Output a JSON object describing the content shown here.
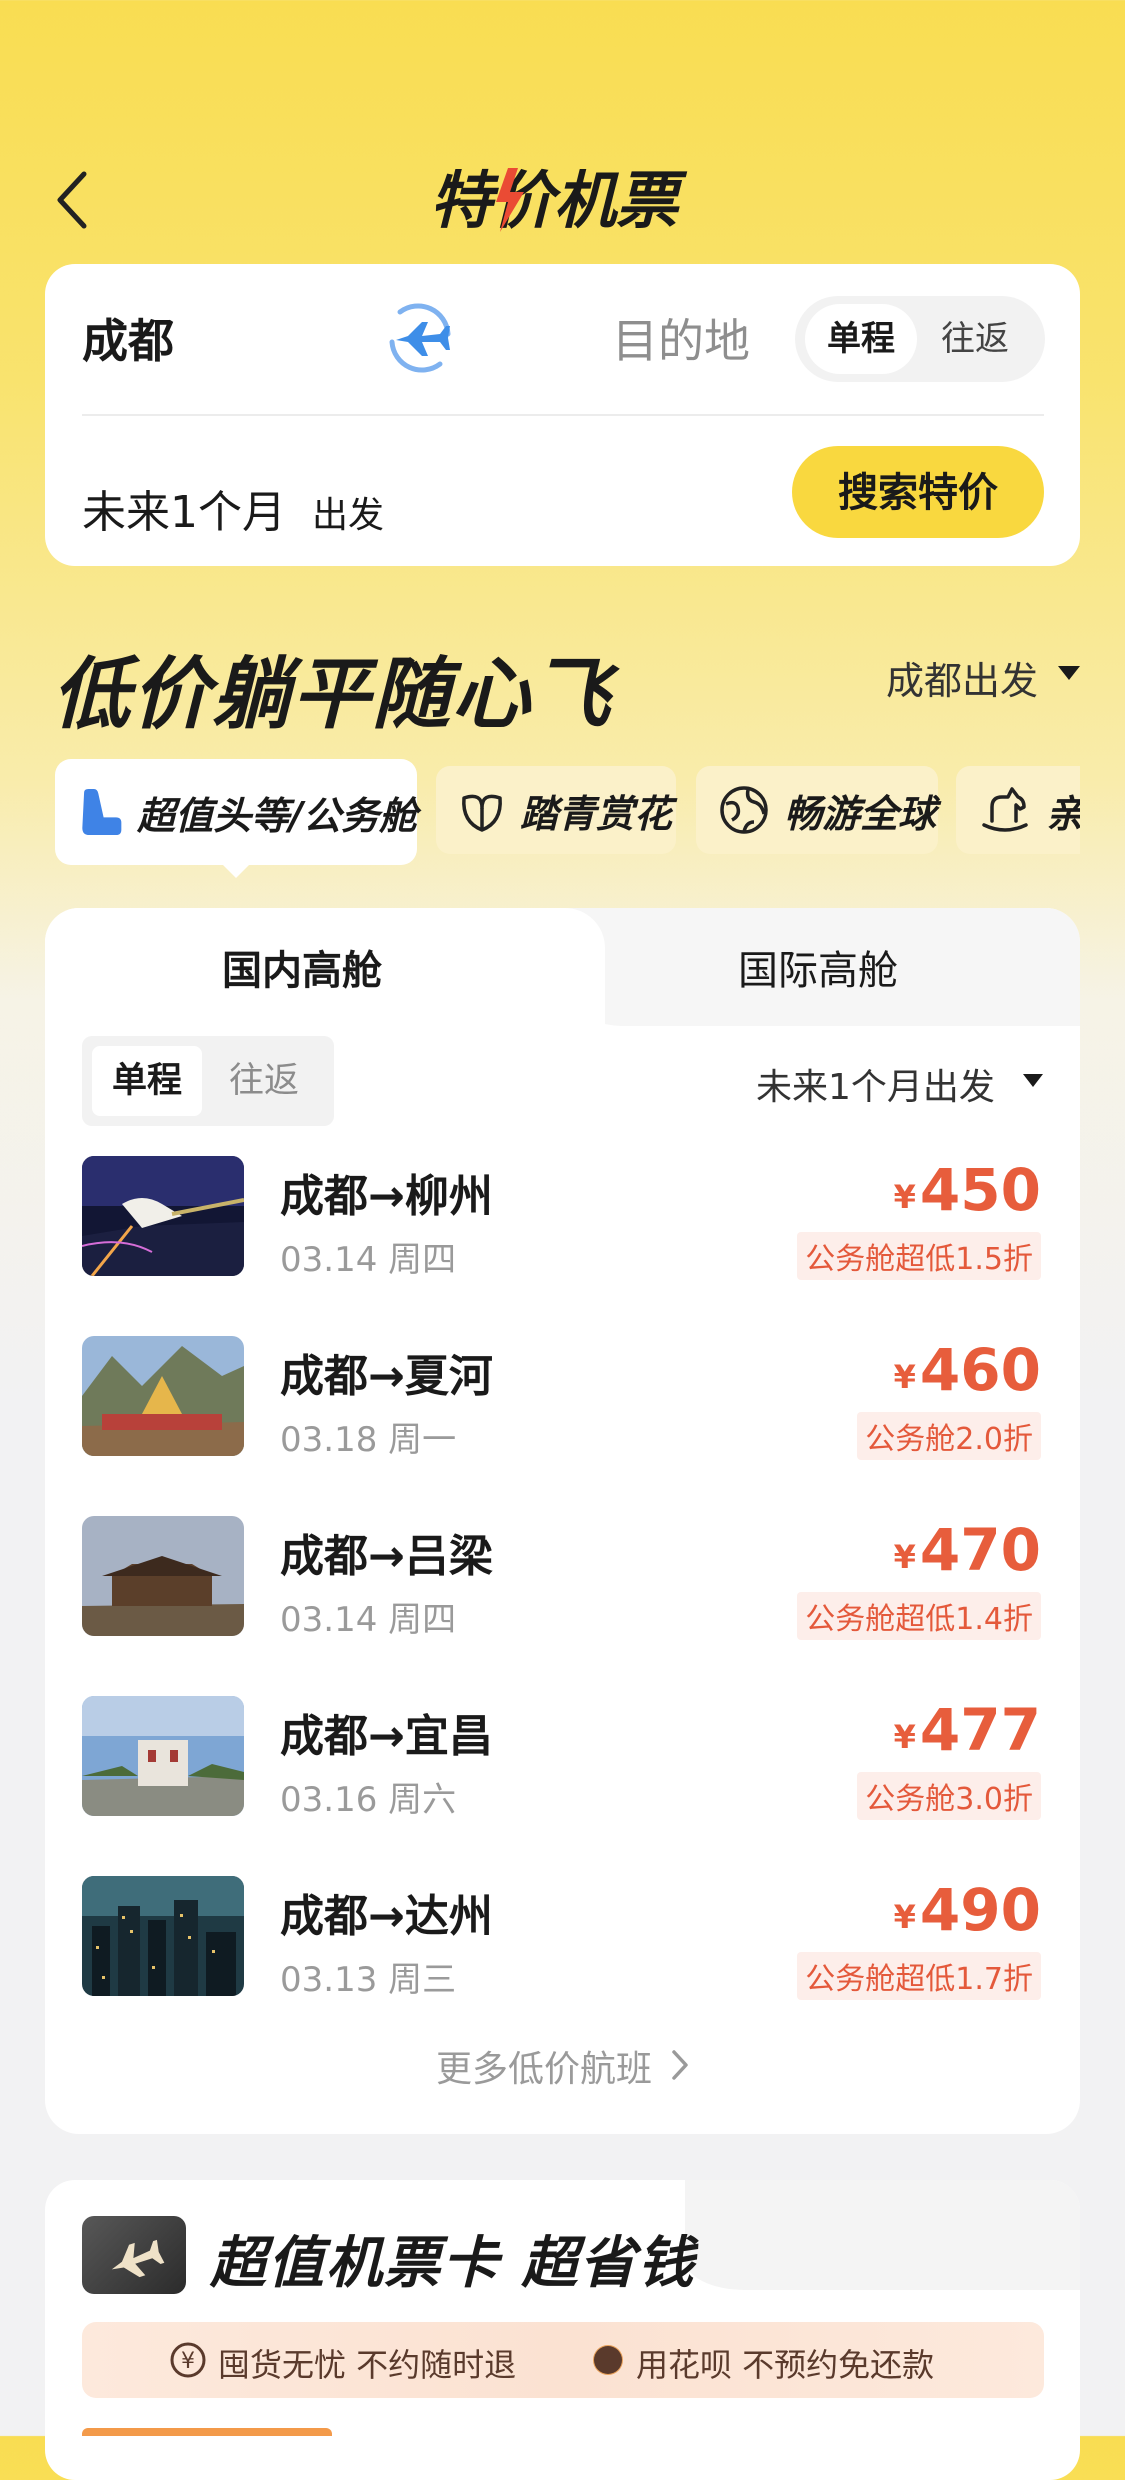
{
  "header": {
    "title": "特价机票"
  },
  "search": {
    "from_city": "成都",
    "to_placeholder": "目的地",
    "trip_types": [
      "单程",
      "往返"
    ],
    "depart_range": "未来1个月",
    "depart_suffix": "出发",
    "search_label": "搜索特价"
  },
  "section": {
    "heading": "低价躺平随心飞",
    "origin_filter": "成都出发",
    "categories": [
      {
        "label": "超值头等/公务舱",
        "icon": "seat-icon"
      },
      {
        "label": "踏青赏花",
        "icon": "flower-icon"
      },
      {
        "label": "畅游全球",
        "icon": "globe-icon"
      },
      {
        "label": "亲子",
        "icon": "rocking-horse-icon"
      }
    ]
  },
  "list": {
    "tabs": [
      "国内高舱",
      "国际高舱"
    ],
    "trip_types": [
      "单程",
      "往返"
    ],
    "date_filter": "未来1个月出发",
    "currency": "¥",
    "flights": [
      {
        "route": "成都→柳州",
        "date": "03.14 周四",
        "price": "450",
        "badge": "公务舱超低1.5折"
      },
      {
        "route": "成都→夏河",
        "date": "03.18 周一",
        "price": "460",
        "badge": "公务舱2.0折"
      },
      {
        "route": "成都→吕梁",
        "date": "03.14 周四",
        "price": "470",
        "badge": "公务舱超低1.4折"
      },
      {
        "route": "成都→宜昌",
        "date": "03.16 周六",
        "price": "477",
        "badge": "公务舱3.0折"
      },
      {
        "route": "成都→达州",
        "date": "03.13 周三",
        "price": "490",
        "badge": "公务舱超低1.7折"
      }
    ],
    "more_label": "更多低价航班"
  },
  "promo": {
    "title": "超值机票卡 超省钱",
    "benefits": [
      "囤货无忧 不约随时退",
      "用花呗 不预约免还款"
    ]
  },
  "colors": {
    "accent_yellow": "#f9d83f",
    "price_red": "#e75d3c",
    "plane_blue": "#3e8ee8"
  }
}
